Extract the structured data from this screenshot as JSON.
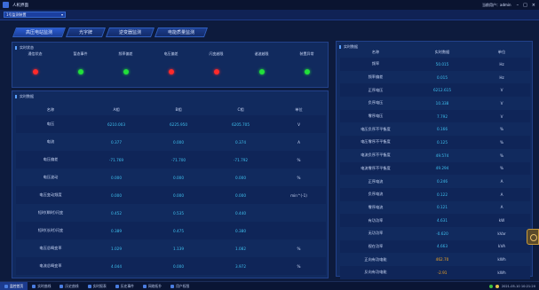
{
  "window": {
    "title": "人机界面",
    "user": "当前用户：admin"
  },
  "toolbar": {
    "device": "1号监测装置"
  },
  "tabs": [
    {
      "label": "高压电站监测",
      "active": true
    },
    {
      "label": "光字牌",
      "active": false
    },
    {
      "label": "逆变器监测",
      "active": false
    },
    {
      "label": "电能质量监测",
      "active": false
    }
  ],
  "status_panel": {
    "title": "实时状态",
    "items": [
      {
        "label": "通信状态",
        "color": "#ff2a2a"
      },
      {
        "label": "暂态事件",
        "color": "#22e03a"
      },
      {
        "label": "频率偏差",
        "color": "#22e03a"
      },
      {
        "label": "电压偏差",
        "color": "#ff2a2a"
      },
      {
        "label": "闪变越限",
        "color": "#ff2a2a"
      },
      {
        "label": "谐波越限",
        "color": "#22e03a"
      },
      {
        "label": "装置异常",
        "color": "#22e03a"
      }
    ]
  },
  "data_panel": {
    "title": "实时数据",
    "headers": [
      "名称",
      "A相",
      "B相",
      "C相",
      "单位"
    ],
    "rows": [
      {
        "name": "电压",
        "a": "6210.003",
        "b": "6225.950",
        "c": "6205.705",
        "unit": "V"
      },
      {
        "name": "电流",
        "a": "0.377",
        "b": "0.000",
        "c": "0.374",
        "unit": "A"
      },
      {
        "name": "电压偏差",
        "a": "-71.769",
        "b": "-71.700",
        "c": "-71.792",
        "unit": "%"
      },
      {
        "name": "电压波动",
        "a": "0.000",
        "b": "0.000",
        "c": "0.000",
        "unit": "%"
      },
      {
        "name": "电压变动频度",
        "a": "0.000",
        "b": "0.000",
        "c": "0.000",
        "unit": "min^(-1)"
      },
      {
        "name": "短时(瞬时)闪变",
        "a": "0.452",
        "b": "0.535",
        "c": "0.440",
        "unit": ""
      },
      {
        "name": "短时(长时)闪变",
        "a": "0.389",
        "b": "0.475",
        "c": "0.380",
        "unit": ""
      },
      {
        "name": "电压总畸变率",
        "a": "1.029",
        "b": "1.139",
        "c": "1.082",
        "unit": "%"
      },
      {
        "name": "电流总畸变率",
        "a": "4.044",
        "b": "0.000",
        "c": "3.972",
        "unit": "%"
      }
    ]
  },
  "rt_panel": {
    "title": "实时数据",
    "headers": [
      "名称",
      "实时数据",
      "单位"
    ],
    "rows": [
      {
        "name": "频率",
        "value": "50.015",
        "unit": "Hz"
      },
      {
        "name": "频率偏差",
        "value": "0.015",
        "unit": "Hz"
      },
      {
        "name": "正序电压",
        "value": "6212.615",
        "unit": "V"
      },
      {
        "name": "负序电压",
        "value": "10.338",
        "unit": "V"
      },
      {
        "name": "零序电压",
        "value": "7.792",
        "unit": "V"
      },
      {
        "name": "电压负序不平衡度",
        "value": "0.166",
        "unit": "%"
      },
      {
        "name": "电压零序不平衡度",
        "value": "0.125",
        "unit": "%"
      },
      {
        "name": "电流负序不平衡度",
        "value": "49.574",
        "unit": "%"
      },
      {
        "name": "电流零序不平衡度",
        "value": "49.294",
        "unit": "%"
      },
      {
        "name": "正序电流",
        "value": "0.246",
        "unit": "A"
      },
      {
        "name": "负序电流",
        "value": "0.122",
        "unit": "A"
      },
      {
        "name": "零序电流",
        "value": "0.121",
        "unit": "A"
      },
      {
        "name": "有功功率",
        "value": "4.631",
        "unit": "kW"
      },
      {
        "name": "无功功率",
        "value": "-0.620",
        "unit": "kVar"
      },
      {
        "name": "视在功率",
        "value": "4.663",
        "unit": "kVA"
      },
      {
        "name": "正向有功电能",
        "value": "462.70",
        "unit": "kWh",
        "highlight": true
      },
      {
        "name": "反向有功电能",
        "value": "-2.91",
        "unit": "kWh",
        "highlight": true
      }
    ]
  },
  "taskbar": {
    "items": [
      {
        "label": "监控首页",
        "active": true
      },
      {
        "label": "实时曲线",
        "active": false
      },
      {
        "label": "历史曲线",
        "active": false
      },
      {
        "label": "实时报表",
        "active": false
      },
      {
        "label": "历史事件",
        "active": false
      },
      {
        "label": "网络拓扑",
        "active": false
      },
      {
        "label": "用户权限",
        "active": false
      }
    ],
    "status": "2021-05-10 10:21:20"
  }
}
